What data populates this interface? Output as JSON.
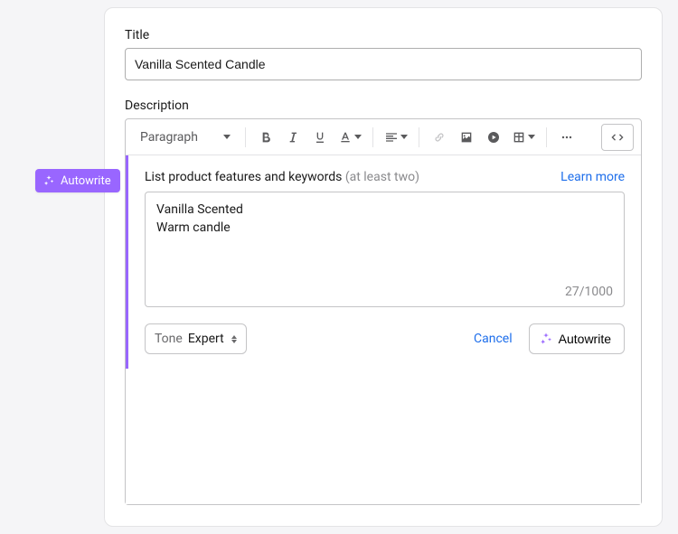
{
  "title_field": {
    "label": "Title",
    "value": "Vanilla Scented Candle"
  },
  "description": {
    "label": "Description",
    "paragraph_style": "Paragraph"
  },
  "autowrite_tab": {
    "label": "Autowrite"
  },
  "autowrite_panel": {
    "prompt_label": "List product features and keywords",
    "prompt_hint": "(at least two)",
    "learn_more": "Learn more",
    "features_text": "Vanilla Scented\nWarm candle",
    "char_count": "27/1000",
    "tone_label": "Tone",
    "tone_value": "Expert",
    "cancel": "Cancel",
    "submit": "Autowrite"
  },
  "colors": {
    "accent": "#9966ff",
    "link": "#1f6feb"
  }
}
